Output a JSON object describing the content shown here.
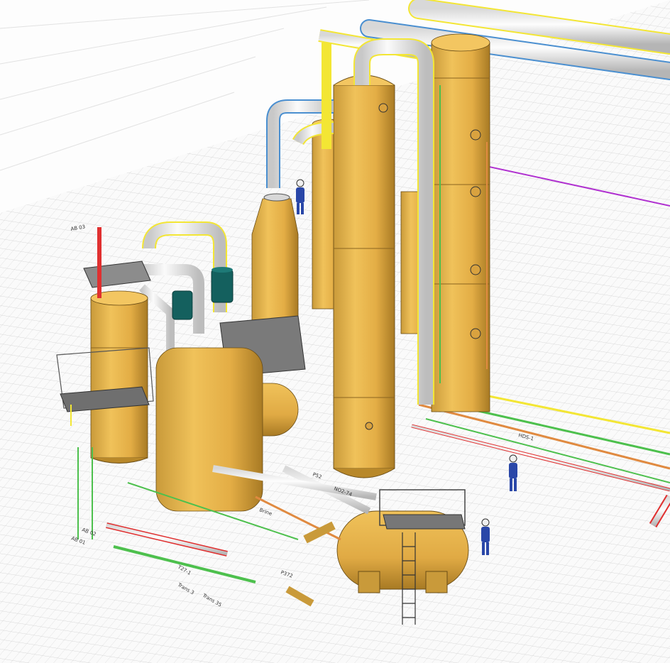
{
  "view": {
    "background": "#fafafa",
    "grid_color": "#c8c8c8",
    "equipment_color": "#e8b54a",
    "equipment_shadow": "#b8882a",
    "pipe_white": "#e6e6e6",
    "pipe_selected": "#f3e634",
    "pipe_blue": "#4a8fd0",
    "pipe_magenta": "#b030d0",
    "pipe_red": "#e03030",
    "pipe_green": "#4dc04d",
    "pipe_orange": "#e08a40",
    "motor_color": "#14605e",
    "worker_suit": "#2a47a8",
    "worker_helmet": "#f0f0f0"
  },
  "labels": {
    "line_tag_1": "AB 01",
    "line_tag_2": "AB 02",
    "line_tag_3": "AB 03",
    "line_tag_4": "NO2-74",
    "line_tag_5": "P52",
    "line_tag_6": "P372",
    "line_tag_7": "T27-1",
    "line_tag_8": "HDS-1",
    "line_tag_9": "Trans 35",
    "line_tag_10": "Trans 3",
    "line_tag_11": "Brine"
  }
}
